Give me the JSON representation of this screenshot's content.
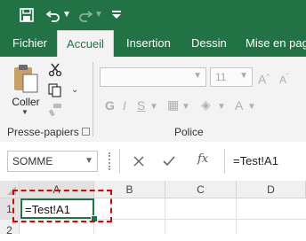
{
  "quick_access": {
    "save_icon": "save-icon",
    "undo_icon": "undo-icon",
    "redo_icon": "redo-icon",
    "customize_icon": "chevron-down-icon"
  },
  "tabs": [
    {
      "label": "Fichier",
      "active": false
    },
    {
      "label": "Accueil",
      "active": true
    },
    {
      "label": "Insertion",
      "active": false
    },
    {
      "label": "Dessin",
      "active": false
    },
    {
      "label": "Mise en page",
      "active": false
    }
  ],
  "clipboard": {
    "paste_label": "Coller",
    "group_label": "Presse-papiers"
  },
  "font": {
    "name_value": "",
    "size_value": "11",
    "group_label": "Police"
  },
  "formula_bar": {
    "name_box": "SOMME",
    "fx_label": "fx",
    "formula": "=Test!A1"
  },
  "sheet": {
    "columns": [
      "A",
      "B",
      "C",
      "D"
    ],
    "rows": [
      "1",
      "2"
    ],
    "active_cell_text": "=Test!A1"
  },
  "colors": {
    "accent": "#217346",
    "highlight": "#e00000"
  }
}
